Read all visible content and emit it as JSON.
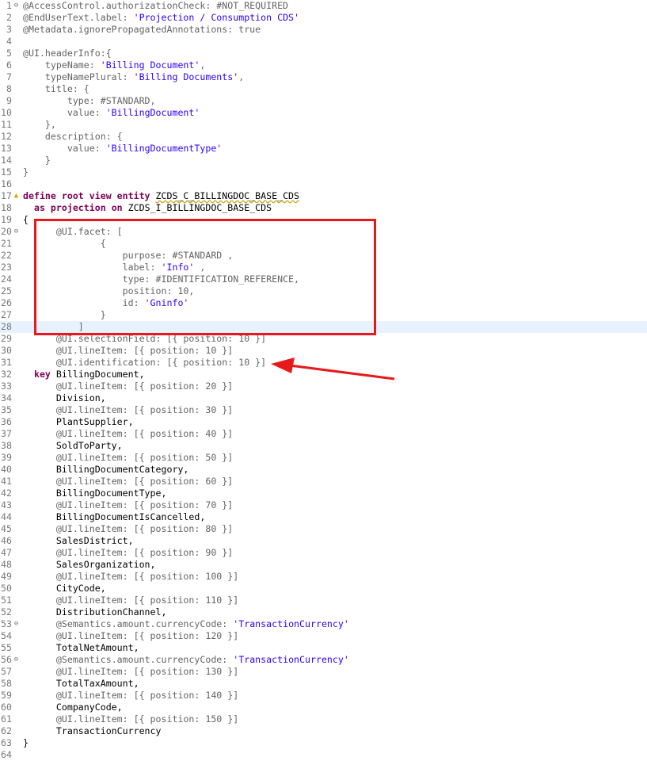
{
  "editor": {
    "lines": [
      {
        "n": "1",
        "fold": "minus",
        "html": "<span class='a'>@AccessControl.authorizationCheck: #NOT_REQUIRED</span>"
      },
      {
        "n": "2",
        "html": "<span class='a'>@EndUserText.label: </span><span class='s'>'Projection / Consumption CDS'</span>"
      },
      {
        "n": "3",
        "html": "<span class='a'>@Metadata.ignorePropagatedAnnotations: true</span>"
      },
      {
        "n": "4",
        "html": ""
      },
      {
        "n": "5",
        "html": "<span class='a'>@UI.headerInfo:{</span>"
      },
      {
        "n": "6",
        "html": "<span class='a'>    typeName: </span><span class='s'>'Billing Document'</span><span class='a'>,</span>"
      },
      {
        "n": "7",
        "html": "<span class='a'>    typeNamePlural: </span><span class='s'>'Billing Documents'</span><span class='a'>,</span>"
      },
      {
        "n": "8",
        "html": "<span class='a'>    title: {</span>"
      },
      {
        "n": "9",
        "html": "<span class='a'>        type: #STANDARD,</span>"
      },
      {
        "n": "10",
        "html": "<span class='a'>        value: </span><span class='s'>'BillingDocument'</span>"
      },
      {
        "n": "11",
        "html": "<span class='a'>    },</span>"
      },
      {
        "n": "12",
        "html": "<span class='a'>    description: {</span>"
      },
      {
        "n": "13",
        "html": "<span class='a'>        value: </span><span class='s'>'BillingDocumentType'</span>"
      },
      {
        "n": "14",
        "html": "<span class='a'>    }</span>"
      },
      {
        "n": "15",
        "html": "<span class='a'>}</span>"
      },
      {
        "n": "16",
        "html": ""
      },
      {
        "n": "17",
        "fold": "warn",
        "html": "<span class='k'>define root view entity</span> <span class='u'>ZCDS_C_BILLINGDOC_BASE_CDS</span>"
      },
      {
        "n": "18",
        "html": "  <span class='k'>as projection on</span> ZCDS_I_BILLINGDOC_BASE_CDS"
      },
      {
        "n": "19",
        "html": "{"
      },
      {
        "n": "20",
        "fold": "minus",
        "html": "      <span class='a'>@UI.facet: [</span>"
      },
      {
        "n": "21",
        "html": "<span class='a'>              {</span>"
      },
      {
        "n": "22",
        "html": "<span class='a'>                  purpose: #STANDARD ,</span>"
      },
      {
        "n": "23",
        "html": "<span class='a'>                  label: </span><span class='s'>'Info'</span><span class='a'> ,</span>"
      },
      {
        "n": "24",
        "html": "<span class='a'>                  type: #IDENTIFICATION_REFERENCE,</span>"
      },
      {
        "n": "25",
        "html": "<span class='a'>                  position: 10,</span>"
      },
      {
        "n": "26",
        "html": "<span class='a'>                  id: </span><span class='s'>'Gninfo'</span>"
      },
      {
        "n": "27",
        "html": "<span class='a'>              }</span>"
      },
      {
        "n": "28",
        "current": true,
        "html": "<span class='a'>          ]</span>"
      },
      {
        "n": "29",
        "html": "      <span class='a'>@UI.selectionField: [{ position: 10 }]</span>"
      },
      {
        "n": "30",
        "html": "      <span class='a'>@UI.lineItem: [{ position: 10 }]</span>"
      },
      {
        "n": "31",
        "html": "      <span class='a'>@UI.identification: [{ position: 10 }]</span>"
      },
      {
        "n": "32",
        "html": "  <span class='k'>key</span> BillingDocument,"
      },
      {
        "n": "33",
        "html": "      <span class='a'>@UI.lineItem: [{ position: 20 }]</span>"
      },
      {
        "n": "34",
        "html": "      Division,"
      },
      {
        "n": "35",
        "html": "      <span class='a'>@UI.lineItem: [{ position: 30 }]</span>"
      },
      {
        "n": "36",
        "html": "      PlantSupplier,"
      },
      {
        "n": "37",
        "html": "      <span class='a'>@UI.lineItem: [{ position: 40 }]</span>"
      },
      {
        "n": "38",
        "html": "      SoldToParty,"
      },
      {
        "n": "39",
        "html": "      <span class='a'>@UI.lineItem: [{ position: 50 }]</span>"
      },
      {
        "n": "40",
        "html": "      BillingDocumentCategory,"
      },
      {
        "n": "41",
        "html": "      <span class='a'>@UI.lineItem: [{ position: 60 }]</span>"
      },
      {
        "n": "42",
        "html": "      BillingDocumentType,"
      },
      {
        "n": "43",
        "html": "      <span class='a'>@UI.lineItem: [{ position: 70 }]</span>"
      },
      {
        "n": "44",
        "html": "      BillingDocumentIsCancelled,"
      },
      {
        "n": "45",
        "html": "      <span class='a'>@UI.lineItem: [{ position: 80 }]</span>"
      },
      {
        "n": "46",
        "html": "      SalesDistrict,"
      },
      {
        "n": "47",
        "html": "      <span class='a'>@UI.lineItem: [{ position: 90 }]</span>"
      },
      {
        "n": "48",
        "html": "      SalesOrganization,"
      },
      {
        "n": "49",
        "html": "      <span class='a'>@UI.lineItem: [{ position: 100 }]</span>"
      },
      {
        "n": "50",
        "html": "      CityCode,"
      },
      {
        "n": "51",
        "html": "      <span class='a'>@UI.lineItem: [{ position: 110 }]</span>"
      },
      {
        "n": "52",
        "html": "      DistributionChannel,"
      },
      {
        "n": "53",
        "fold": "minus",
        "html": "      <span class='a'>@Semantics.amount.currencyCode: </span><span class='s'>'TransactionCurrency'</span>"
      },
      {
        "n": "54",
        "html": "      <span class='a'>@UI.lineItem: [{ position: 120 }]</span>"
      },
      {
        "n": "55",
        "html": "      TotalNetAmount,"
      },
      {
        "n": "56",
        "fold": "minus",
        "html": "      <span class='a'>@Semantics.amount.currencyCode: </span><span class='s'>'TransactionCurrency'</span>"
      },
      {
        "n": "57",
        "html": "      <span class='a'>@UI.lineItem: [{ position: 130 }]</span>"
      },
      {
        "n": "58",
        "html": "      TotalTaxAmount,"
      },
      {
        "n": "59",
        "html": "      <span class='a'>@UI.lineItem: [{ position: 140 }]</span>"
      },
      {
        "n": "60",
        "html": "      CompanyCode,"
      },
      {
        "n": "61",
        "html": "      <span class='a'>@UI.lineItem: [{ position: 150 }]</span>"
      },
      {
        "n": "62",
        "html": "      TransactionCurrency"
      },
      {
        "n": "63",
        "html": "}"
      },
      {
        "n": "64",
        "html": ""
      }
    ]
  },
  "colors": {
    "highlight": "#e8191a",
    "current_line": "#e8f2fe",
    "keyword": "#7f0055",
    "annotation": "#646464",
    "string": "#2a00ff"
  }
}
